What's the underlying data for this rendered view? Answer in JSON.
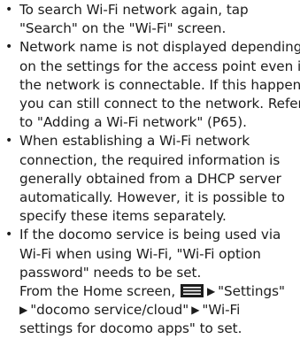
{
  "notes": [
    {
      "lines": [
        "To search Wi-Fi network again, tap",
        "\"Search\" on the \"Wi-Fi\" screen."
      ]
    },
    {
      "lines": [
        "Network name is not displayed depending",
        "on the settings for the access point even if",
        "the network is connectable. If this happens,",
        "you can still connect to the network. Refer",
        "to \"Adding a Wi-Fi network\" (P65)."
      ]
    },
    {
      "lines": [
        "When establishing a Wi-Fi network",
        "connection, the required information is",
        "generally obtained from a DHCP server",
        "automatically. However, it is possible to",
        "specify these items separately."
      ]
    },
    {
      "lines": [
        "If the docomo service is being used via",
        "Wi-Fi when using Wi-Fi, \"Wi-Fi option",
        "password\" needs to be set."
      ],
      "nav": {
        "intro": "From the Home screen,",
        "menu_icon": "menu-icon",
        "step1": "\"Settings\"",
        "step2": "\"docomo service/cloud\"",
        "step3_a": "\"Wi-Fi",
        "step3_b": "settings for docomo apps\" to set."
      }
    }
  ],
  "bullet_char": "•",
  "arrow_char": "▶"
}
